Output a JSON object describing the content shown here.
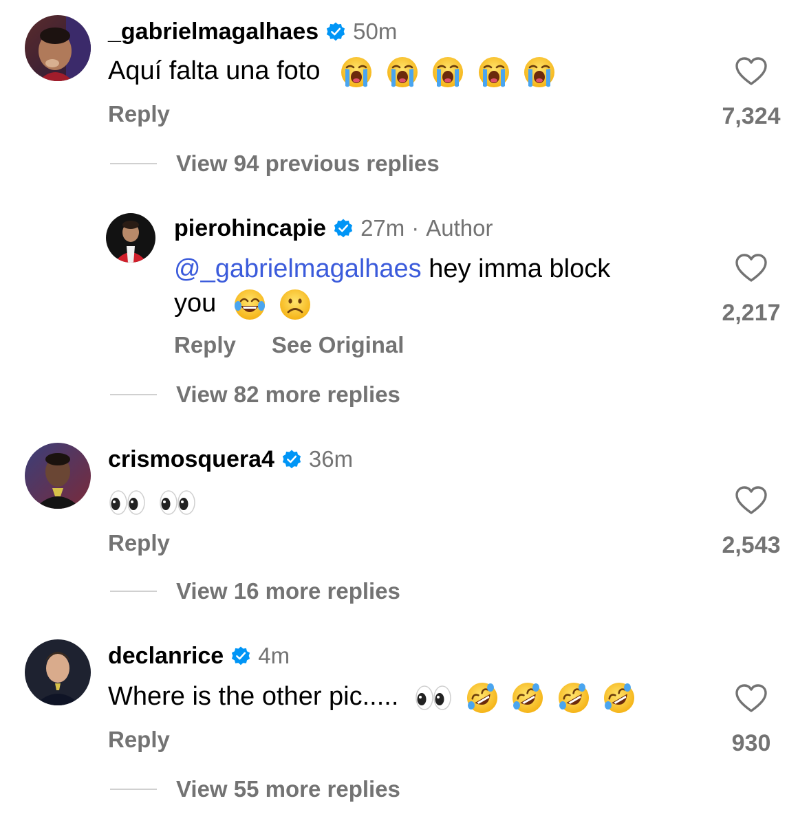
{
  "comments": [
    {
      "username": "_gabrielmagalhaes",
      "verified": true,
      "time": "50m",
      "text": "Aquí falta una foto",
      "emojis": [
        "loudly-crying-face",
        "loudly-crying-face",
        "loudly-crying-face",
        "loudly-crying-face",
        "loudly-crying-face"
      ],
      "reply_label": "Reply",
      "likes": "7,324",
      "view_replies": "View 94 previous replies"
    },
    {
      "username": "pierohincapie",
      "verified": true,
      "time": "27m",
      "separator": "·",
      "author_label": "Author",
      "mention": "@_gabrielmagalhaes",
      "text_line1": "hey imma block",
      "text_line2": "you",
      "emojis": [
        "face-with-tears-of-joy",
        "frowning-face"
      ],
      "reply_label": "Reply",
      "see_original_label": "See Original",
      "likes": "2,217",
      "view_replies": "View 82 more replies"
    },
    {
      "username": "crismosquera4",
      "verified": true,
      "time": "36m",
      "emojis": [
        "eyes",
        "eyes"
      ],
      "reply_label": "Reply",
      "likes": "2,543",
      "view_replies": "View 16 more replies"
    },
    {
      "username": "declanrice",
      "verified": true,
      "time": "4m",
      "text": "Where is the other pic.....",
      "emojis": [
        "eyes",
        "rolling-on-the-floor-laughing",
        "rolling-on-the-floor-laughing",
        "rolling-on-the-floor-laughing",
        "rolling-on-the-floor-laughing"
      ],
      "reply_label": "Reply",
      "likes": "930",
      "view_replies": "View 55 more replies"
    }
  ],
  "colors": {
    "username": "#000000",
    "secondary": "#737373",
    "mention": "#3b5bdb",
    "verified": "#0095f6",
    "divider": "#d0d0d0"
  }
}
